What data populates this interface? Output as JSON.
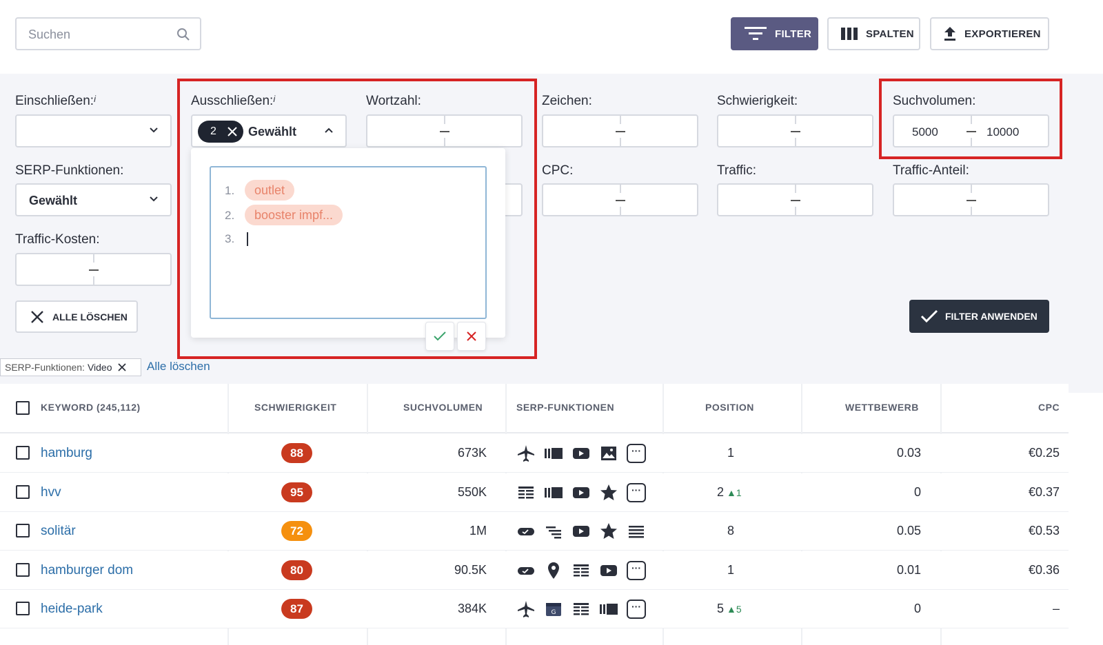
{
  "toolbar": {
    "search_placeholder": "Suchen",
    "filter_label": "FILTER",
    "columns_label": "SPALTEN",
    "export_label": "EXPORTIEREN"
  },
  "filters": {
    "include_label": "Einschließen:",
    "include_info": "i",
    "exclude_label": "Ausschließen:",
    "exclude_info": "i",
    "exclude_count": "2",
    "exclude_value": "Gewählt",
    "word_count_label": "Wortzahl:",
    "chars_label": "Zeichen:",
    "difficulty_label": "Schwierigkeit:",
    "volume_label": "Suchvolumen:",
    "volume_min": "5000",
    "volume_max": "10000",
    "serp_label": "SERP-Funktionen:",
    "serp_value": "Gewählt",
    "cpc_label": "CPC:",
    "traffic_label": "Traffic:",
    "traffic_share_label": "Traffic-Anteil:",
    "traffic_cost_label": "Traffic-Kosten:",
    "range_sep": "–",
    "clear_all_label": "ALLE LÖSCHEN",
    "apply_label": "FILTER ANWENDEN"
  },
  "exclude_popup": {
    "lines": [
      {
        "n": "1.",
        "tag": "outlet"
      },
      {
        "n": "2.",
        "tag": "booster impf..."
      },
      {
        "n": "3.",
        "tag": ""
      }
    ]
  },
  "active_filters": {
    "chip_key": "SERP-Funktionen:",
    "chip_value": "Video",
    "clear_link": "Alle löschen"
  },
  "table": {
    "headers": {
      "keyword": "KEYWORD",
      "keyword_count": "(245,112)",
      "difficulty": "SCHWIERIGKEIT",
      "volume": "SUCHVOLUMEN",
      "serp": "SERP-FUNKTIONEN",
      "position": "POSITION",
      "competition": "WETTBEWERB",
      "cpc": "CPC"
    },
    "rows": [
      {
        "keyword": "hamburg",
        "difficulty": "88",
        "diff_color": "#c93a1f",
        "volume": "673K",
        "position": "1",
        "pos_change": "",
        "competition": "0.03",
        "cpc": "€0.25"
      },
      {
        "keyword": "hvv",
        "difficulty": "95",
        "diff_color": "#c93a1f",
        "volume": "550K",
        "position": "2",
        "pos_change": "▲1",
        "competition": "0",
        "cpc": "€0.37"
      },
      {
        "keyword": "solitär",
        "difficulty": "72",
        "diff_color": "#f5900f",
        "volume": "1M",
        "position": "8",
        "pos_change": "",
        "competition": "0.05",
        "cpc": "€0.53"
      },
      {
        "keyword": "hamburger dom",
        "difficulty": "80",
        "diff_color": "#c93a1f",
        "volume": "90.5K",
        "position": "1",
        "pos_change": "",
        "competition": "0.01",
        "cpc": "€0.36"
      },
      {
        "keyword": "heide-park",
        "difficulty": "87",
        "diff_color": "#c93a1f",
        "volume": "384K",
        "position": "5",
        "pos_change": "▲5",
        "competition": "0",
        "cpc": "–"
      }
    ],
    "more_glyph": "···"
  }
}
